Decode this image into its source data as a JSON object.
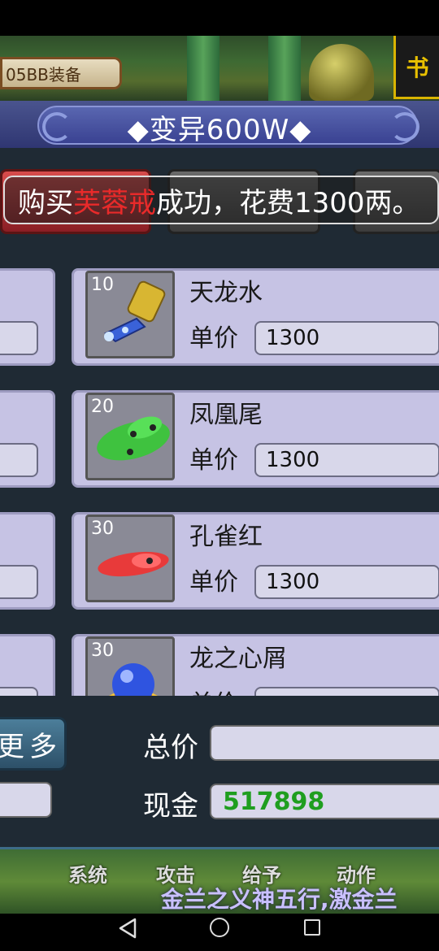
{
  "header": {
    "equip_tag": "05BB装备",
    "book_tab": "书",
    "title": "◆变异600W◆"
  },
  "toast": {
    "prefix": "购买",
    "item": "芙蓉戒",
    "suffix": "成功，花费1300两。"
  },
  "items": [
    {
      "level": "10",
      "name": "天龙水",
      "price_label": "单价",
      "price": "1300",
      "icon": "gold-lantern-icon"
    },
    {
      "level": "20",
      "name": "凤凰尾",
      "price_label": "单价",
      "price": "1300",
      "icon": "green-feather-icon"
    },
    {
      "level": "30",
      "name": "孔雀红",
      "price_label": "单价",
      "price": "1300",
      "icon": "red-feather-icon"
    },
    {
      "level": "30",
      "name": "龙之心屑",
      "price_label": "单价",
      "price": "",
      "icon": "blue-orb-icon"
    }
  ],
  "footer": {
    "more_label": "更多",
    "total_label": "总价",
    "total_value": "",
    "cash_label": "现金",
    "cash_value": "517898"
  },
  "bottom_menu": {
    "items": [
      "系统",
      "攻击",
      "给予",
      "动作"
    ],
    "ticker": "金兰之义神五行,激金兰"
  },
  "colors": {
    "toast_highlight": "#e82a2a",
    "cash_text": "#1f9e1f",
    "title_bg": "#3a4292",
    "item_bg": "#c6c3e4"
  }
}
